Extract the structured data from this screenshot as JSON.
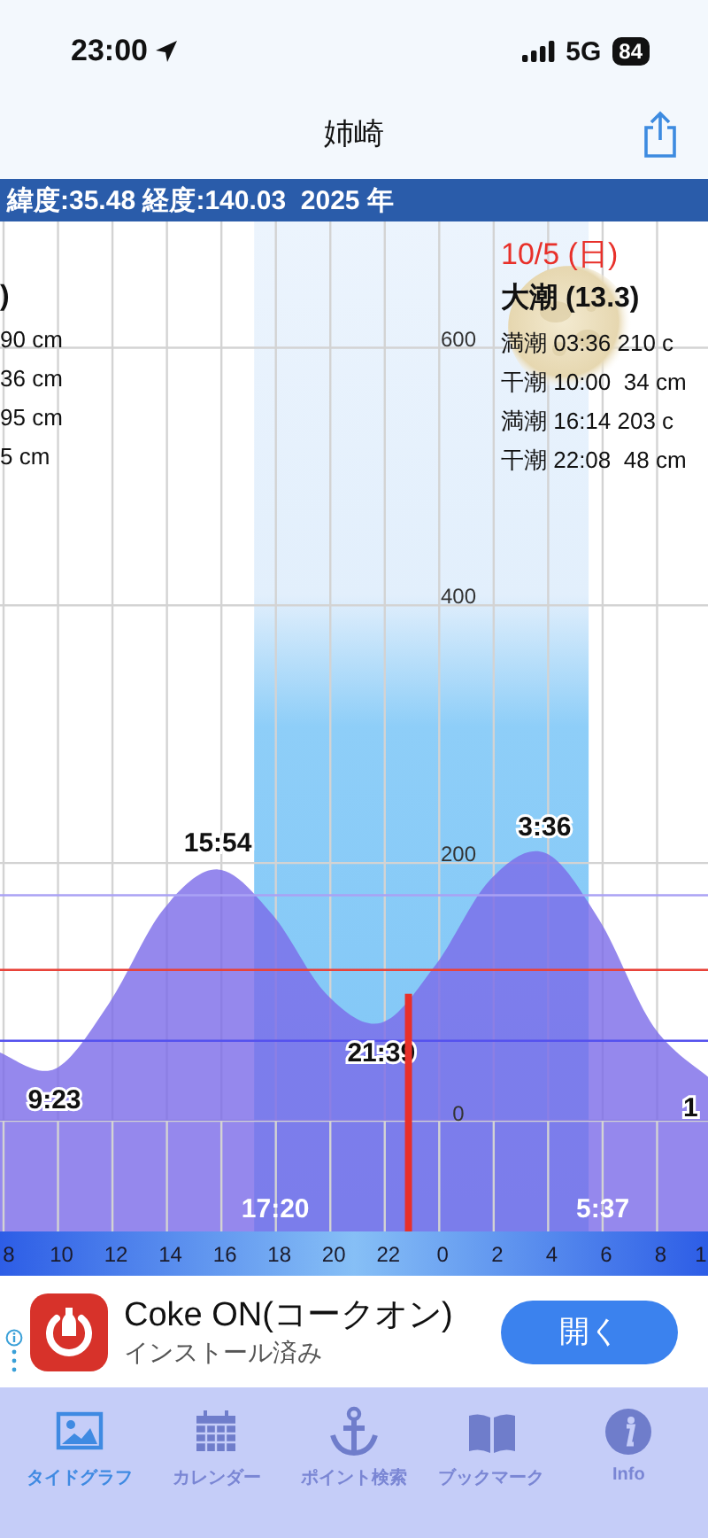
{
  "status_bar": {
    "time": "23:00",
    "network": "5G",
    "battery": "84"
  },
  "nav": {
    "title": "姉崎"
  },
  "location_bar": {
    "text": "緯度:35.48 経度:140.03  2025 年"
  },
  "tide_chart": {
    "previous_day": {
      "heading": ")",
      "lines": [
        "90 cm",
        "36 cm",
        "95 cm",
        "5 cm"
      ]
    },
    "day": {
      "date": "10/5 (日)",
      "tide_name": "大潮 (13.3)",
      "lines": [
        "満潮 03:36 210 c",
        "干潮 10:00  34 cm",
        "満潮 16:14 203 c",
        "干潮 22:08  48 cm"
      ]
    },
    "night": {
      "sunset": "17:20",
      "sunrise": "5:37"
    },
    "extremes": [
      "9:23",
      "15:54",
      "21:39",
      "3:36",
      "1"
    ],
    "chart_data": {
      "type": "area",
      "categories": [
        "8",
        "10",
        "12",
        "14",
        "16",
        "18",
        "20",
        "22",
        "0",
        "2",
        "4",
        "6",
        "8",
        "1"
      ],
      "series": [
        {
          "color": "#7a6ae8",
          "values": [
            53,
            40,
            91,
            164,
            195,
            160,
            98,
            76,
            121,
            187,
            208,
            156,
            73,
            34
          ]
        }
      ],
      "ylim": [
        -86,
        698
      ],
      "yticks": [
        0,
        200,
        400,
        600
      ],
      "grid": true,
      "ref_lines": [
        {
          "axis": "y",
          "value": 175,
          "color": "#aaa2f4"
        },
        {
          "axis": "y",
          "value": 117,
          "color": "#e8433a"
        },
        {
          "axis": "y",
          "value": 62,
          "color": "#5552ee"
        }
      ]
    }
  },
  "ad": {
    "title": "Coke ON(コークオン)",
    "subtitle": "インストール済み",
    "button": "開く"
  },
  "tab_bar": {
    "tabs": [
      {
        "label": "タイドグラフ",
        "kind": "picture",
        "selected": true
      },
      {
        "label": "カレンダー",
        "kind": "calendar",
        "selected": false
      },
      {
        "label": "ポイント検索",
        "kind": "anchor",
        "selected": false
      },
      {
        "label": "ブックマーク",
        "kind": "book",
        "selected": false
      },
      {
        "label": "Info",
        "kind": "info",
        "selected": false
      }
    ]
  }
}
